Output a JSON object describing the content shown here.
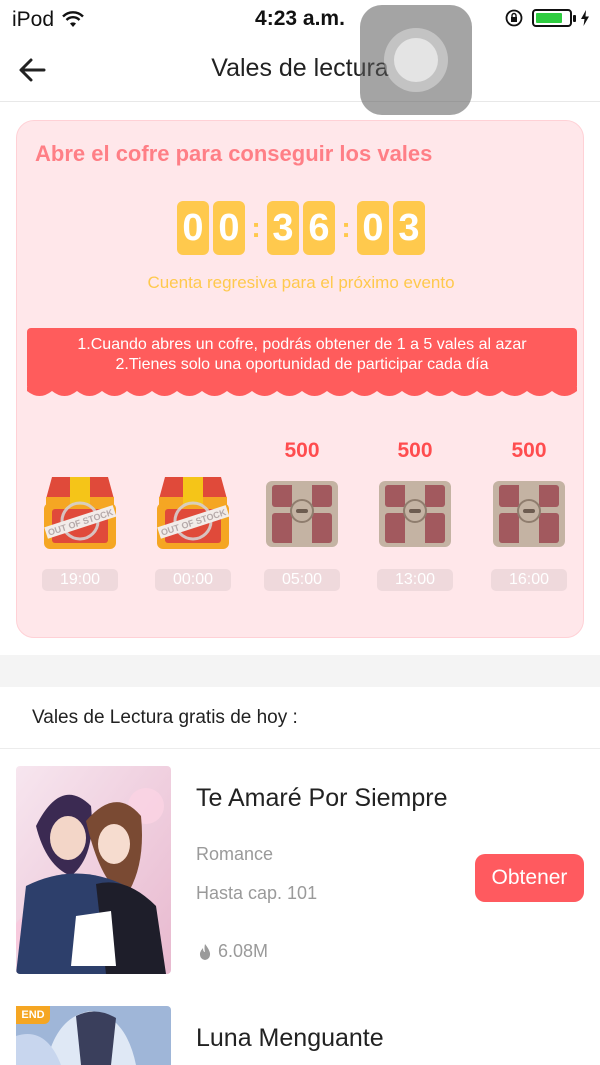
{
  "status_bar": {
    "carrier": "iPod",
    "time": "4:23 a.m.",
    "battery_level": 0.8
  },
  "nav": {
    "title": "Vales de lectura"
  },
  "event": {
    "title": "Abre el cofre para conseguir los vales",
    "countdown": {
      "hours": [
        "0",
        "0"
      ],
      "minutes": [
        "3",
        "6"
      ],
      "seconds": [
        "0",
        "3"
      ]
    },
    "countdown_label": "Cuenta regresiva para el próximo evento",
    "rules": [
      "1.Cuando abres un cofre, podrás obtener de 1 a 5 vales al azar",
      "2.Tienes solo una oportunidad de participar cada día"
    ],
    "chests": [
      {
        "price": "",
        "state": "out-of-stock",
        "stamp": "OUT OF STOCK",
        "time": "19:00"
      },
      {
        "price": "",
        "state": "out-of-stock",
        "stamp": "OUT OF STOCK",
        "time": "00:00"
      },
      {
        "price": "500",
        "state": "locked",
        "time": "05:00"
      },
      {
        "price": "500",
        "state": "locked",
        "time": "13:00"
      },
      {
        "price": "500",
        "state": "locked",
        "time": "16:00"
      }
    ]
  },
  "section": {
    "heading": "Vales de Lectura gratis de hoy :"
  },
  "books": [
    {
      "title": "Te Amaré Por Siempre",
      "genre": "Romance",
      "chapters": "Hasta cap. 101",
      "views": "6.08M",
      "button": "Obtener",
      "badge": ""
    },
    {
      "title": "Luna Menguante",
      "badge": "END"
    }
  ],
  "colors": {
    "accent": "#ff5a5f",
    "card_bg": "#ffe7ea",
    "gold": "#ffc94d",
    "title_pink": "#ff7f86"
  }
}
